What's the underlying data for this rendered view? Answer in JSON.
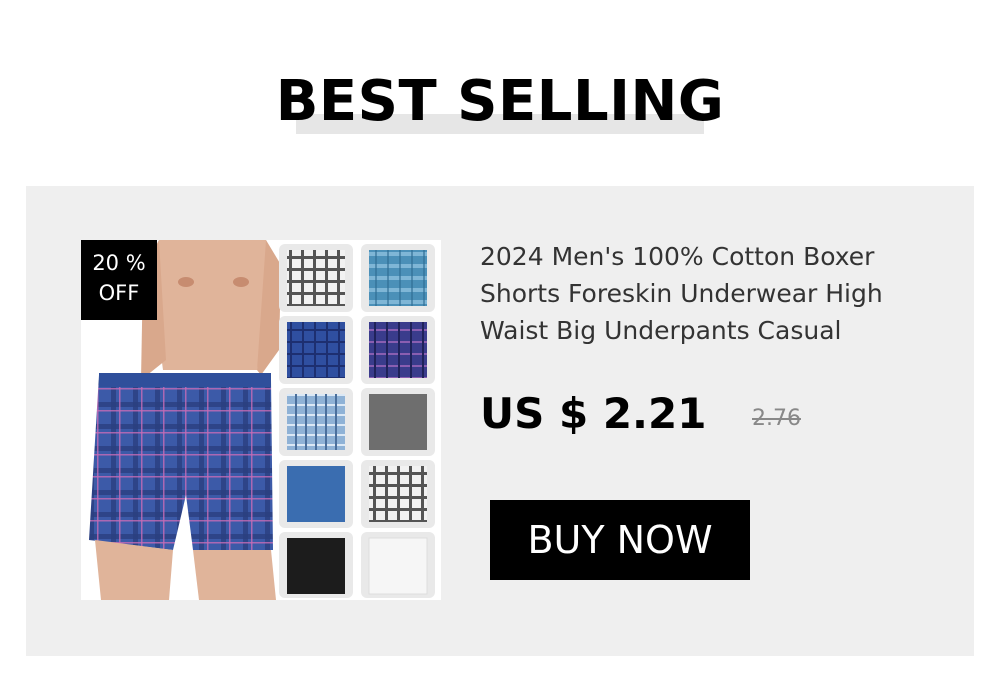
{
  "header": {
    "title": "BEST SELLING"
  },
  "product": {
    "image_icon": "boxer-shorts-product-photo",
    "discount_badge": {
      "line1": "20 %",
      "line2": "OFF"
    },
    "title": "2024 Men's 100% Cotton Boxer Shorts Foreskin Underwear High Waist Big Underpants Casual",
    "price": "US $ 2.21",
    "old_price": "2.76",
    "buy_button_label": "BUY NOW"
  },
  "colors": {
    "card_background": "#efefef",
    "accent": "#000000",
    "title_underline": "#e6e6e6",
    "old_price": "#888888"
  }
}
